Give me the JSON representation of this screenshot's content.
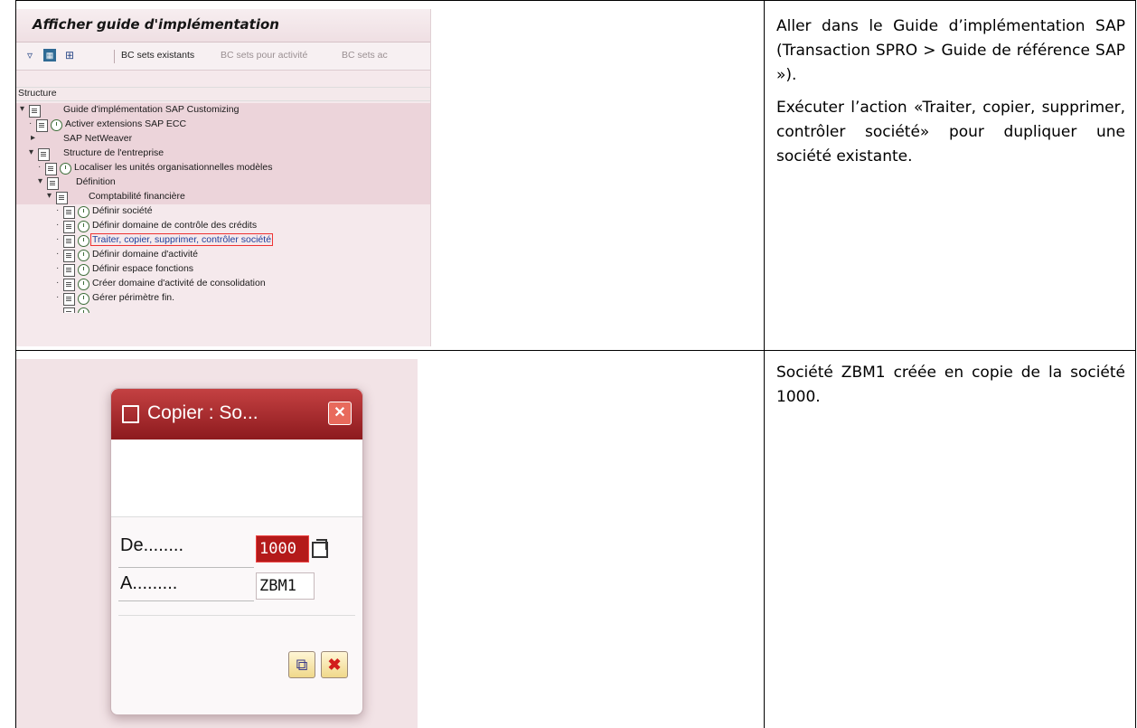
{
  "row1": {
    "screenshot": {
      "title": "Afficher guide d'implémentation",
      "toolbar": {
        "bc_sets_existants": "BC sets existants",
        "bc_sets_activite": "BC sets pour activité",
        "bc_sets_ac": "BC sets ac"
      },
      "structure_label": "Structure",
      "tree": [
        {
          "label": "Guide d'implémentation SAP Customizing"
        },
        {
          "label": "Activer extensions SAP ECC"
        },
        {
          "label": "SAP NetWeaver"
        },
        {
          "label": "Structure de l'entreprise"
        },
        {
          "label": "Localiser les unités organisationnelles modèles"
        },
        {
          "label": "Définition"
        },
        {
          "label": "Comptabilité financière"
        },
        {
          "label": "Définir société"
        },
        {
          "label": "Définir domaine de contrôle des crédits"
        },
        {
          "label": "Traiter, copier, supprimer, contrôler société"
        },
        {
          "label": "Définir domaine d'activité"
        },
        {
          "label": "Définir espace fonctions"
        },
        {
          "label": "Créer domaine d'activité de consolidation"
        },
        {
          "label": "Gérer périmètre fin."
        }
      ]
    },
    "description": [
      "Aller dans le Guide d’implémentation SAP (Transaction SPRO > Guide de référence SAP »).",
      "Exécuter l’action «Traiter, copier, supprimer, contrôler société» pour dupliquer une société existante."
    ]
  },
  "row2": {
    "dialog": {
      "title": "Copier : So...",
      "close_symbol": "✕",
      "from_label": "De........",
      "from_value": "1000",
      "to_label": "A.........",
      "to_value": "ZBM1",
      "cancel_symbol": "✖",
      "ok_symbol": "⧉"
    },
    "description": [
      "Société ZBM1 créée en copie de la société 1000."
    ]
  },
  "colors": {
    "sap_band": "#ecd4da",
    "dialog_title": "#a82a2e",
    "field_active": "#b41a1a",
    "link_blue": "#1f3e9a"
  }
}
